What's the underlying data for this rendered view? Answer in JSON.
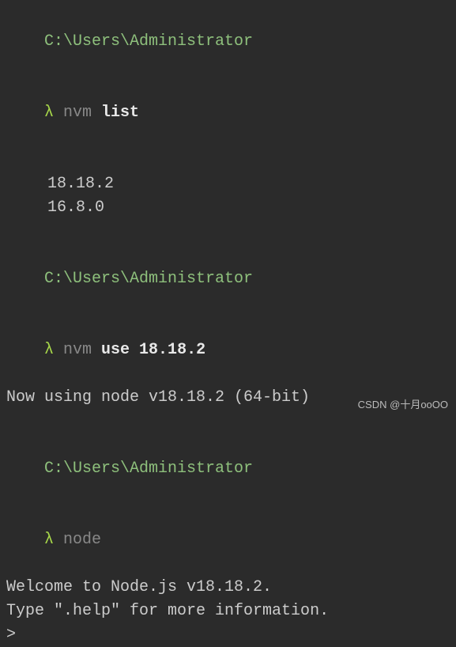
{
  "block1": {
    "path": "C:\\Users\\Administrator",
    "lambda": "λ",
    "cmd_prefix": " nvm ",
    "cmd_main": "list",
    "versions": [
      "18.18.2",
      "16.8.0"
    ]
  },
  "block2": {
    "path": "C:\\Users\\Administrator",
    "lambda": "λ",
    "cmd_prefix": " nvm ",
    "cmd_main": "use 18.18.2",
    "output": "Now using node v18.18.2 (64-bit)"
  },
  "block3": {
    "path": "C:\\Users\\Administrator",
    "lambda": "λ",
    "cmd": " node",
    "welcome": "Welcome to Node.js v18.18.2.",
    "help": "Type \".help\" for more information.",
    "prompt": ">"
  },
  "watermark": "CSDN @十月ooOO"
}
